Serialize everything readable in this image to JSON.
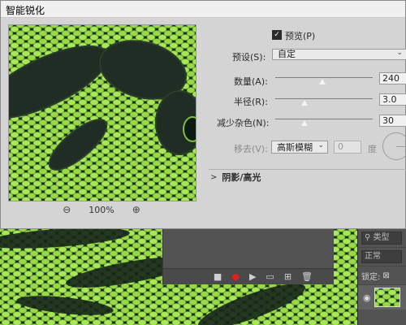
{
  "dialog": {
    "title": "智能锐化",
    "preview_checkbox_label": "预览(P)",
    "preview_checked": true,
    "preset": {
      "label": "预设(S):",
      "value": "自定"
    },
    "amount": {
      "label": "数量(A):",
      "value": "240",
      "level_fraction": 0.48
    },
    "radius": {
      "label": "半径(R):",
      "value": "3.0",
      "level_fraction": 0.3
    },
    "reduce_noise": {
      "label": "减少杂色(N):",
      "value": "30",
      "level_fraction": 0.3
    },
    "remove": {
      "label": "移去(V):",
      "value": "高斯模糊",
      "angle_value": "0",
      "angle_unit": "度"
    },
    "shadows_highlights_label": "阴影/高光",
    "zoom": {
      "level": "100%",
      "zoom_out_icon": "zoom-out-icon",
      "zoom_in_icon": "zoom-in-icon"
    }
  },
  "layers_panel": {
    "search_label": "类型",
    "blend_mode": "正常",
    "lock_label": "锁定:"
  },
  "actions_toolbar": {
    "icons": [
      "stop-icon",
      "record-icon",
      "play-icon",
      "new-set-icon",
      "new-action-icon",
      "delete-icon"
    ]
  },
  "colors": {
    "dialog_bg": "#d4d4d4",
    "record_red": "#e02020",
    "workspace_bg": "#535353"
  }
}
